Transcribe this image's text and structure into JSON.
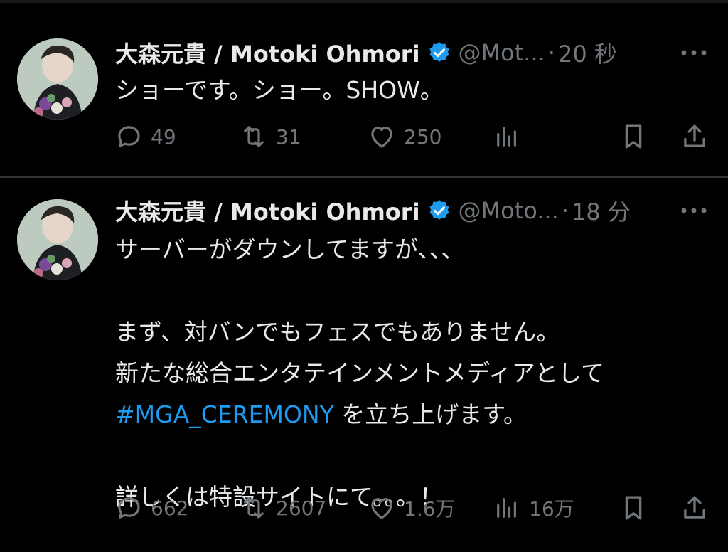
{
  "colors": {
    "background": "#000000",
    "text": "#e7e9ea",
    "muted": "#71767b",
    "link": "#1d9bf0",
    "verified": "#1d9bf0"
  },
  "tweets": [
    {
      "name": "大森元貴 / Motoki Ohmori",
      "handle": "@Mot...",
      "time": "20 秒",
      "lines": [
        "ショーです。ショー。SHOW。"
      ],
      "replies": "49",
      "retweets": "31",
      "likes": "250",
      "views": ""
    },
    {
      "name": "大森元貴 / Motoki Ohmori",
      "handle": "@Moto...",
      "time": "18 分",
      "line1": "サーバーがダウンしてますが、、、",
      "line2": "まず、対バンでもフェスでもありません。",
      "line3": "新たな総合エンタテインメントメディアとして",
      "hashtag": "#MGA_CEREMONY",
      "line4_rest": " を立ち上げます。",
      "line5": "詳しくは特設サイトにて。。。！",
      "replies": "662",
      "retweets": "2607",
      "likes": "1.6万",
      "views": "16万"
    }
  ],
  "icons": [
    "verified-badge-icon",
    "more-icon",
    "reply-icon",
    "retweet-icon",
    "like-icon",
    "views-icon",
    "bookmark-icon",
    "share-icon"
  ]
}
